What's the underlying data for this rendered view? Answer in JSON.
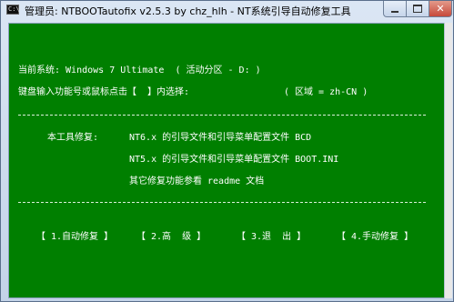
{
  "window": {
    "title": "管理员: NTBOOTautofix v2.5.3 by chz_hlh - NT系统引导自动修复工具",
    "icon_text": "C:\\"
  },
  "console": {
    "current_system": "当前系统: Windows 7 Ultimate  ( 活动分区 - D: )",
    "prompt": "键盘输入功能号或鼠标点击【  】内选择:",
    "region": "( 区域 = zh-CN )",
    "tool_fix_label": "本工具修复:",
    "nt6_line": "NT6.x 的引导文件和引导菜单配置文件 BCD",
    "nt5_line": "NT5.x 的引导文件和引导菜单配置文件 BOOT.INI",
    "other_line": "其它修复功能参看 readme 文档",
    "divider": "--------------------------------------------------------------------------------"
  },
  "menu": {
    "auto": "【 1.自动修复 】",
    "advanced": "【 2.高  级 】",
    "exit": "【 3.退  出 】",
    "manual": "【 4.手动修复 】"
  },
  "colors": {
    "console_bg": "#007f00",
    "console_fg": "#ffffff",
    "close_button": "#c7493a"
  }
}
